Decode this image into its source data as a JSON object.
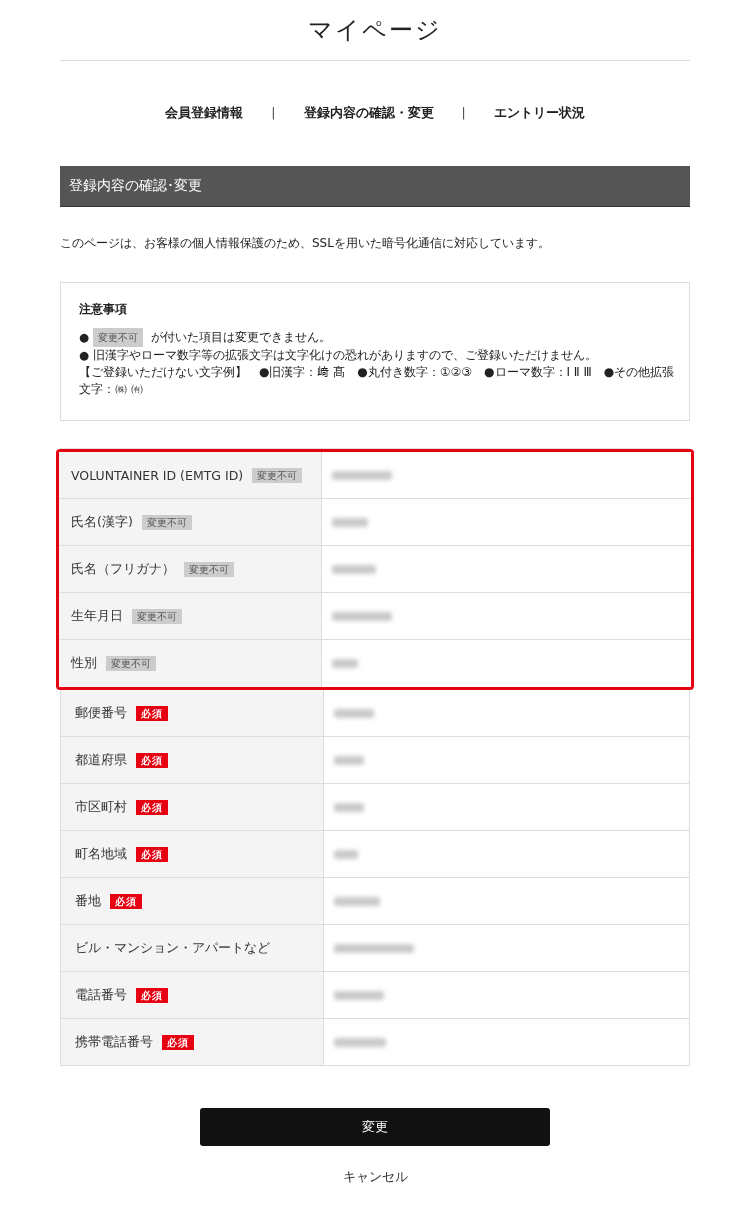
{
  "page_title": "マイページ",
  "nav": [
    {
      "label": "会員登録情報",
      "selected": false
    },
    {
      "label": "登録内容の確認・変更",
      "selected": false
    },
    {
      "label": "エントリー状況",
      "selected": false
    }
  ],
  "nav_separator": "|",
  "section_title": "登録内容の確認･変更",
  "intro": "このページは、お客様の個人情報保護のため、SSLを用いた暗号化通信に対応しています。",
  "notice": {
    "title": "注意事項",
    "lines": [
      {
        "kind": "badge",
        "bullet": "●",
        "badge": "変更不可",
        "text": "が付いた項目は変更できません。"
      },
      {
        "kind": "plain",
        "bullet": "●",
        "text": "旧漢字やローマ数字等の拡張文字は文字化けの恐れがありますので、ご登録いただけません。"
      },
      {
        "kind": "small",
        "text": "【ご登録いただけない文字例】　●旧漢字：﨑 髙　●丸付き数字：①②③　●ローマ数字：Ⅰ Ⅱ Ⅲ　●その他拡張文字：㈱ ㈲"
      }
    ]
  },
  "rows": [
    {
      "label": "VOLUNTAINER ID (EMTG ID)",
      "kind": "locked",
      "badge": "変更不可",
      "highlighted": true
    },
    {
      "label": "氏名(漢字)",
      "kind": "locked",
      "badge": "変更不可",
      "highlighted": true
    },
    {
      "label": "氏名（フリガナ）",
      "kind": "locked",
      "badge": "変更不可",
      "highlighted": true
    },
    {
      "label": "生年月日",
      "kind": "locked",
      "badge": "変更不可",
      "highlighted": true
    },
    {
      "label": "性別",
      "kind": "locked",
      "badge": "変更不可",
      "highlighted": true
    },
    {
      "label": "郵便番号",
      "kind": "required",
      "badge": "必須",
      "highlighted": false
    },
    {
      "label": "都道府県",
      "kind": "required",
      "badge": "必須",
      "highlighted": false
    },
    {
      "label": "市区町村",
      "kind": "required",
      "badge": "必須",
      "highlighted": false
    },
    {
      "label": "町名地域",
      "kind": "required",
      "badge": "必須",
      "highlighted": false
    },
    {
      "label": "番地",
      "kind": "required",
      "badge": "必須",
      "highlighted": false
    },
    {
      "label": "ビル・マンション・アパートなど",
      "kind": "none",
      "highlighted": false
    },
    {
      "label": "電話番号",
      "kind": "required",
      "badge": "必須",
      "highlighted": false
    },
    {
      "label": "携帯電話番号",
      "kind": "required",
      "badge": "必須",
      "highlighted": false
    }
  ],
  "submit_button": "変更",
  "cancel_link": "キャンセル"
}
